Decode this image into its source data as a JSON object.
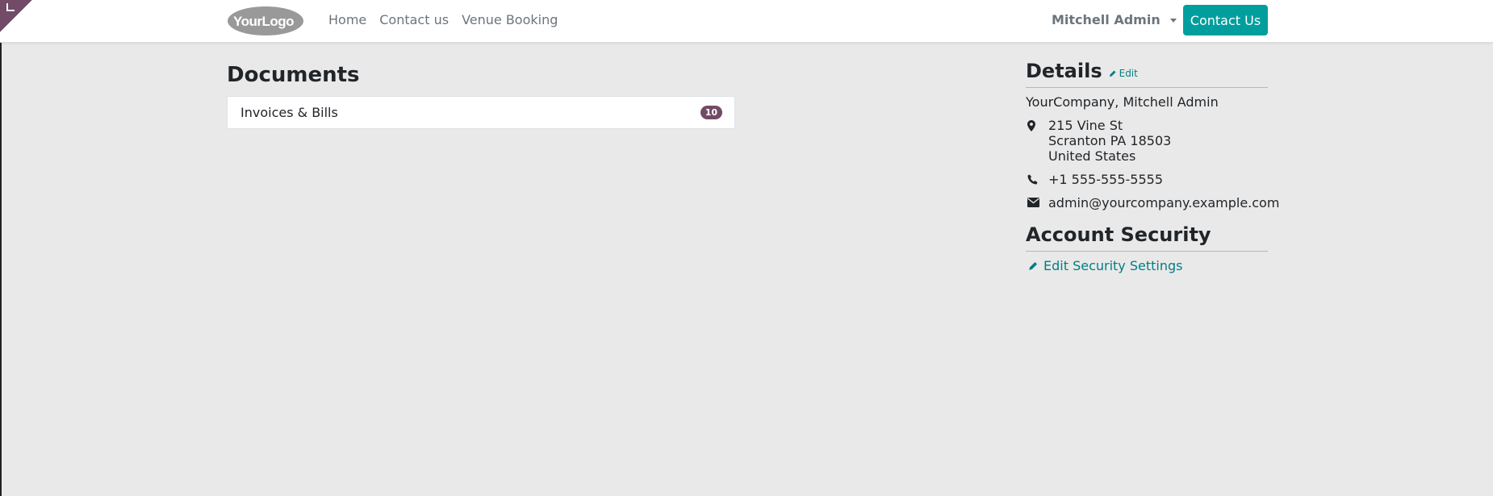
{
  "header": {
    "logo_text": "YourLogo",
    "nav": [
      "Home",
      "Contact us",
      "Venue Booking"
    ],
    "user_name": "Mitchell Admin",
    "contact_button": "Contact Us"
  },
  "documents": {
    "title": "Documents",
    "items": [
      {
        "label": "Invoices & Bills",
        "count": "10"
      }
    ]
  },
  "details": {
    "title": "Details",
    "edit_label": "Edit",
    "company": "YourCompany, Mitchell Admin",
    "address_lines": [
      "215 Vine St",
      "Scranton PA 18503",
      "United States"
    ],
    "phone": "+1 555-555-5555",
    "email": "admin@yourcompany.example.com"
  },
  "security": {
    "title": "Account Security",
    "edit_label": "Edit Security Settings"
  },
  "colors": {
    "brand": "#714b67",
    "accent": "#019e9e",
    "link": "#017e84"
  }
}
